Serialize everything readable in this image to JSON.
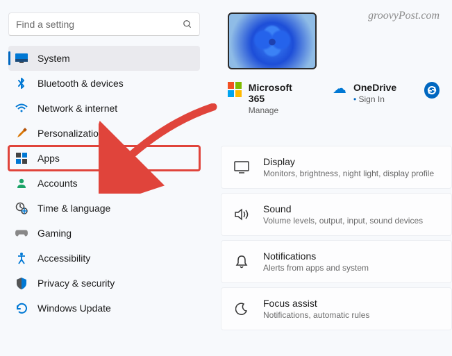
{
  "watermark": "groovyPost.com",
  "search": {
    "placeholder": "Find a setting"
  },
  "sidebar": {
    "items": [
      {
        "label": "System"
      },
      {
        "label": "Bluetooth & devices"
      },
      {
        "label": "Network & internet"
      },
      {
        "label": "Personalization"
      },
      {
        "label": "Apps"
      },
      {
        "label": "Accounts"
      },
      {
        "label": "Time & language"
      },
      {
        "label": "Gaming"
      },
      {
        "label": "Accessibility"
      },
      {
        "label": "Privacy & security"
      },
      {
        "label": "Windows Update"
      }
    ]
  },
  "accounts": {
    "ms365": {
      "title": "Microsoft 365",
      "subtitle": "Manage"
    },
    "onedrive": {
      "title": "OneDrive",
      "subtitle": "Sign In"
    }
  },
  "cards": {
    "display": {
      "title": "Display",
      "desc": "Monitors, brightness, night light, display profile"
    },
    "sound": {
      "title": "Sound",
      "desc": "Volume levels, output, input, sound devices"
    },
    "notifications": {
      "title": "Notifications",
      "desc": "Alerts from apps and system"
    },
    "focus": {
      "title": "Focus assist",
      "desc": "Notifications, automatic rules"
    }
  }
}
